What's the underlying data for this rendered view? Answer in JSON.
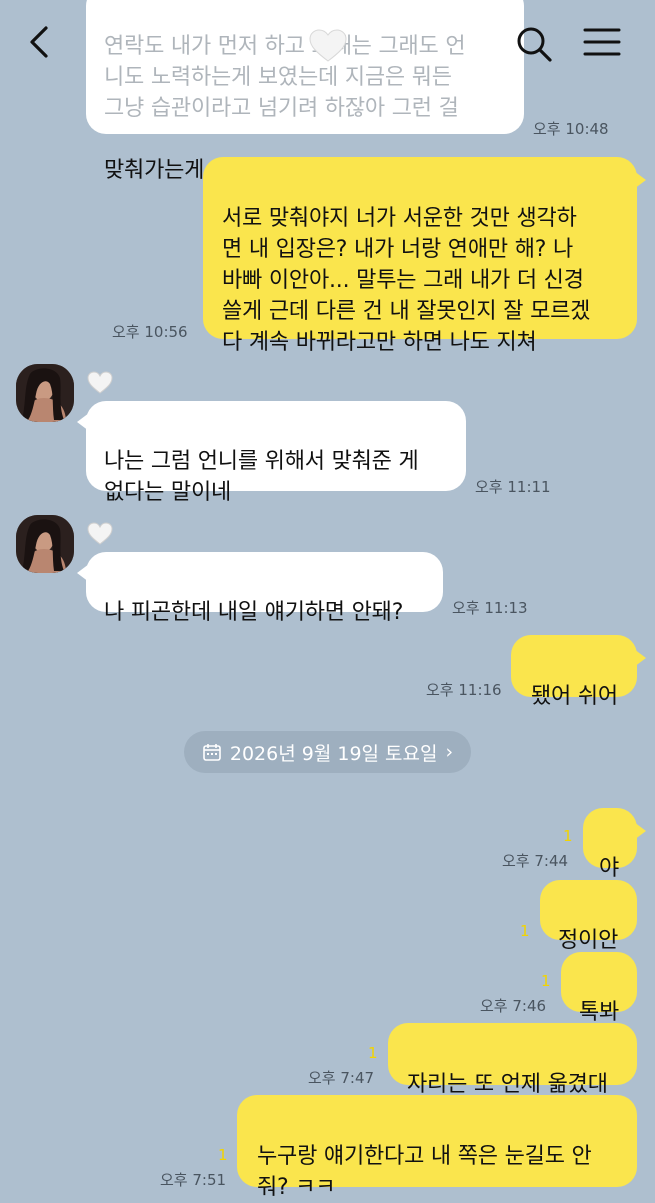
{
  "header": {
    "back_icon": "back-arrow-icon",
    "search_icon": "search-icon",
    "menu_icon": "hamburger-menu-icon"
  },
  "messages": {
    "m0": {
      "faded_text": "연락도 내가 먼저 하고 그때는 그래도 언\n니도 노력하는게 보였는데 지금은 뭐든\n그냥 습관이라고 넘기려 하잖아 그런 걸",
      "text": "맞춰가는게 연애고 사랑 아니야?",
      "time": "오후 10:48"
    },
    "m1": {
      "text": "서로 맞춰야지 너가 서운한 것만 생각하\n면 내 입장은? 내가 너랑 연애만 해? 나\n바빠 이안아... 말투는 그래 내가 더 신경\n쓸게 근데 다른 건 내 잘못인지 잘 모르겠\n다 계속 바뀌라고만 하면 나도 지쳐",
      "time": "오후 10:56"
    },
    "m2": {
      "text": "나는 그럼 언니를 위해서 맞춰준 게\n없다는 말이네",
      "time": "오후 11:11"
    },
    "m3": {
      "text": "나 피곤한데 내일 얘기하면 안돼?",
      "time": "오후 11:13"
    },
    "m4": {
      "text": "됐어 쉬어",
      "time": "오후 11:16"
    },
    "date_divider": {
      "label": "2026년 9월 19일 토요일",
      "chevron": "›"
    },
    "m5": {
      "text": "야",
      "unread": "1",
      "time": "오후 7:44"
    },
    "m6": {
      "text": "정이안",
      "unread": "1"
    },
    "m7": {
      "text": "톡봐",
      "unread": "1",
      "time": "오후 7:46"
    },
    "m8": {
      "text": "자리는 또 언제 옮겼대",
      "unread": "1",
      "time": "오후 7:47"
    },
    "m9": {
      "text": "누구랑 얘기한다고 내 쪽은 눈길도 안\n줘? ㅋㅋ",
      "unread": "1",
      "time": "오후 7:51"
    }
  },
  "colors": {
    "background": "#aebfcf",
    "outgoing_bubble": "#fae54d",
    "incoming_bubble": "#ffffff",
    "unread_count": "#f2d400"
  }
}
